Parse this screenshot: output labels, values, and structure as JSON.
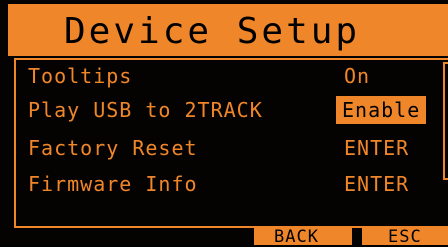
{
  "title": "Device Setup",
  "menu": {
    "items": [
      {
        "label": "Tooltips",
        "value": "On"
      },
      {
        "label": "Play USB to 2TRACK",
        "value": "Enable"
      },
      {
        "label": "Factory Reset",
        "value": "ENTER"
      },
      {
        "label": "Firmware Info",
        "value": "ENTER"
      }
    ]
  },
  "footer": {
    "back_label": "BACK",
    "esc_label": "ESC"
  },
  "colors": {
    "accent": "#f0862a",
    "background": "#050302",
    "text_on_accent": "#000000"
  }
}
